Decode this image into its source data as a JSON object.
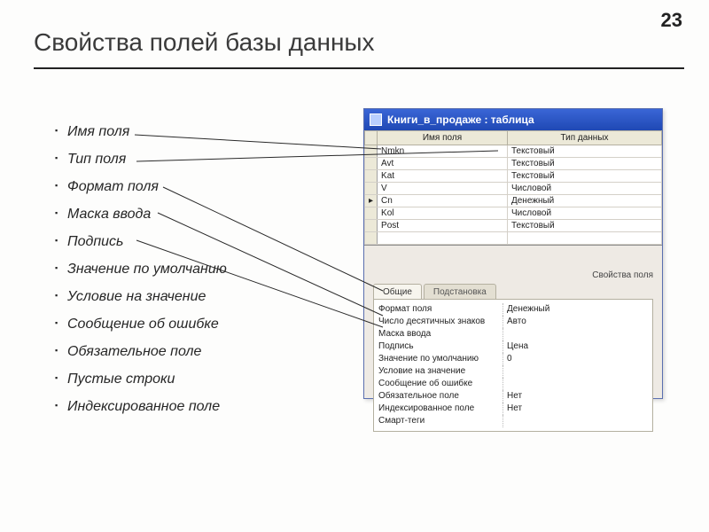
{
  "page_number": "23",
  "title": "Свойства полей базы данных",
  "bullets": [
    "Имя поля",
    "Тип поля",
    "Формат поля",
    "Маска ввода",
    "Подпись",
    "Значение по умолчанию",
    "Условие на значение",
    "Сообщение об ошибке",
    "Обязательное поле",
    "Пустые строки",
    "Индексированное поле"
  ],
  "window": {
    "title": "Книги_в_продаже : таблица",
    "columns": [
      "Имя поля",
      "Тип данных"
    ],
    "rows": [
      {
        "name": "Nmkn",
        "type": "Текстовый"
      },
      {
        "name": "Avt",
        "type": "Текстовый"
      },
      {
        "name": "Kat",
        "type": "Текстовый"
      },
      {
        "name": "V",
        "type": "Числовой"
      },
      {
        "name": "Cn",
        "type": "Денежный",
        "selected": true
      },
      {
        "name": "Kol",
        "type": "Числовой"
      },
      {
        "name": "Post",
        "type": "Текстовый"
      }
    ],
    "section_label": "Свойства поля",
    "tabs": {
      "active": "Общие",
      "inactive": "Подстановка"
    },
    "properties": [
      {
        "label": "Формат поля",
        "value": "Денежный"
      },
      {
        "label": "Число десятичных знаков",
        "value": "Авто"
      },
      {
        "label": "Маска ввода",
        "value": ""
      },
      {
        "label": "Подпись",
        "value": "Цена"
      },
      {
        "label": "Значение по умолчанию",
        "value": "0"
      },
      {
        "label": "Условие на значение",
        "value": ""
      },
      {
        "label": "Сообщение об ошибке",
        "value": ""
      },
      {
        "label": "Обязательное поле",
        "value": "Нет"
      },
      {
        "label": "Индексированное поле",
        "value": "Нет"
      },
      {
        "label": "Смарт-теги",
        "value": ""
      }
    ]
  }
}
